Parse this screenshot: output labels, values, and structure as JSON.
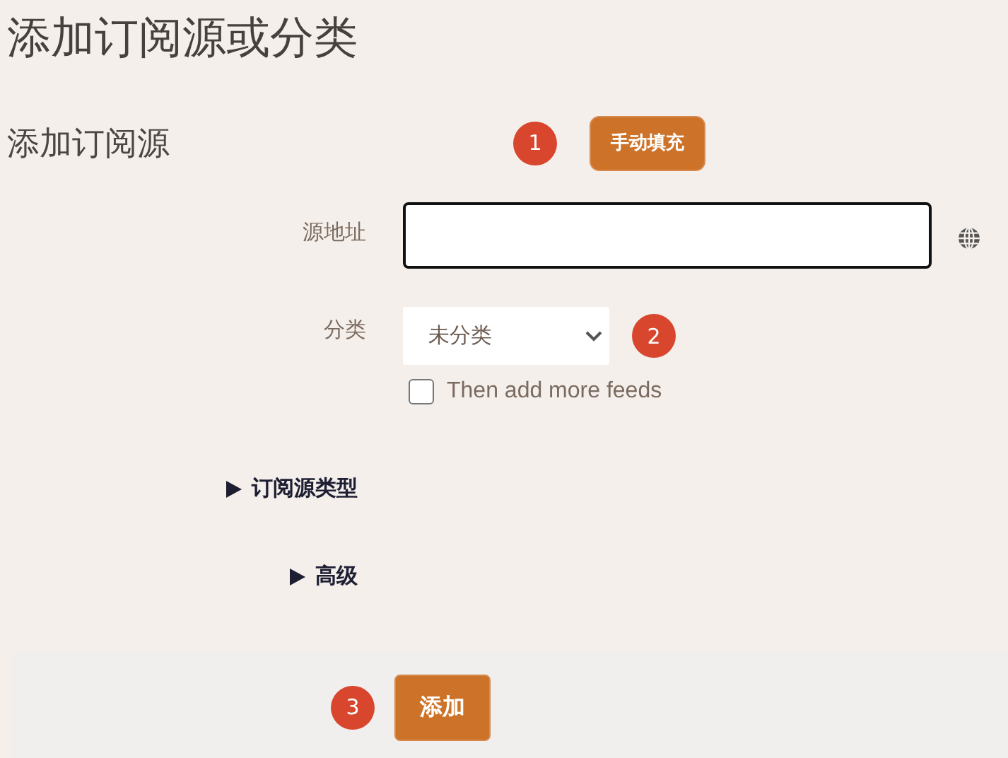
{
  "page_title": "添加订阅源或分类",
  "section_title": "添加订阅源",
  "steps": [
    {
      "number": "1"
    },
    {
      "number": "2"
    },
    {
      "number": "3"
    }
  ],
  "manual_fill_button": "手动填充",
  "fields": [
    {
      "kind": "text",
      "label": "源地址",
      "focused": true
    },
    {
      "kind": "select",
      "label": "分类",
      "value": "未分类"
    }
  ],
  "more_feeds": {
    "label": "Then add more feeds",
    "checked": false
  },
  "sections": [
    {
      "label": "订阅源类型",
      "expanded": false
    },
    {
      "label": "高级",
      "expanded": false
    }
  ],
  "submit_button": "添加"
}
